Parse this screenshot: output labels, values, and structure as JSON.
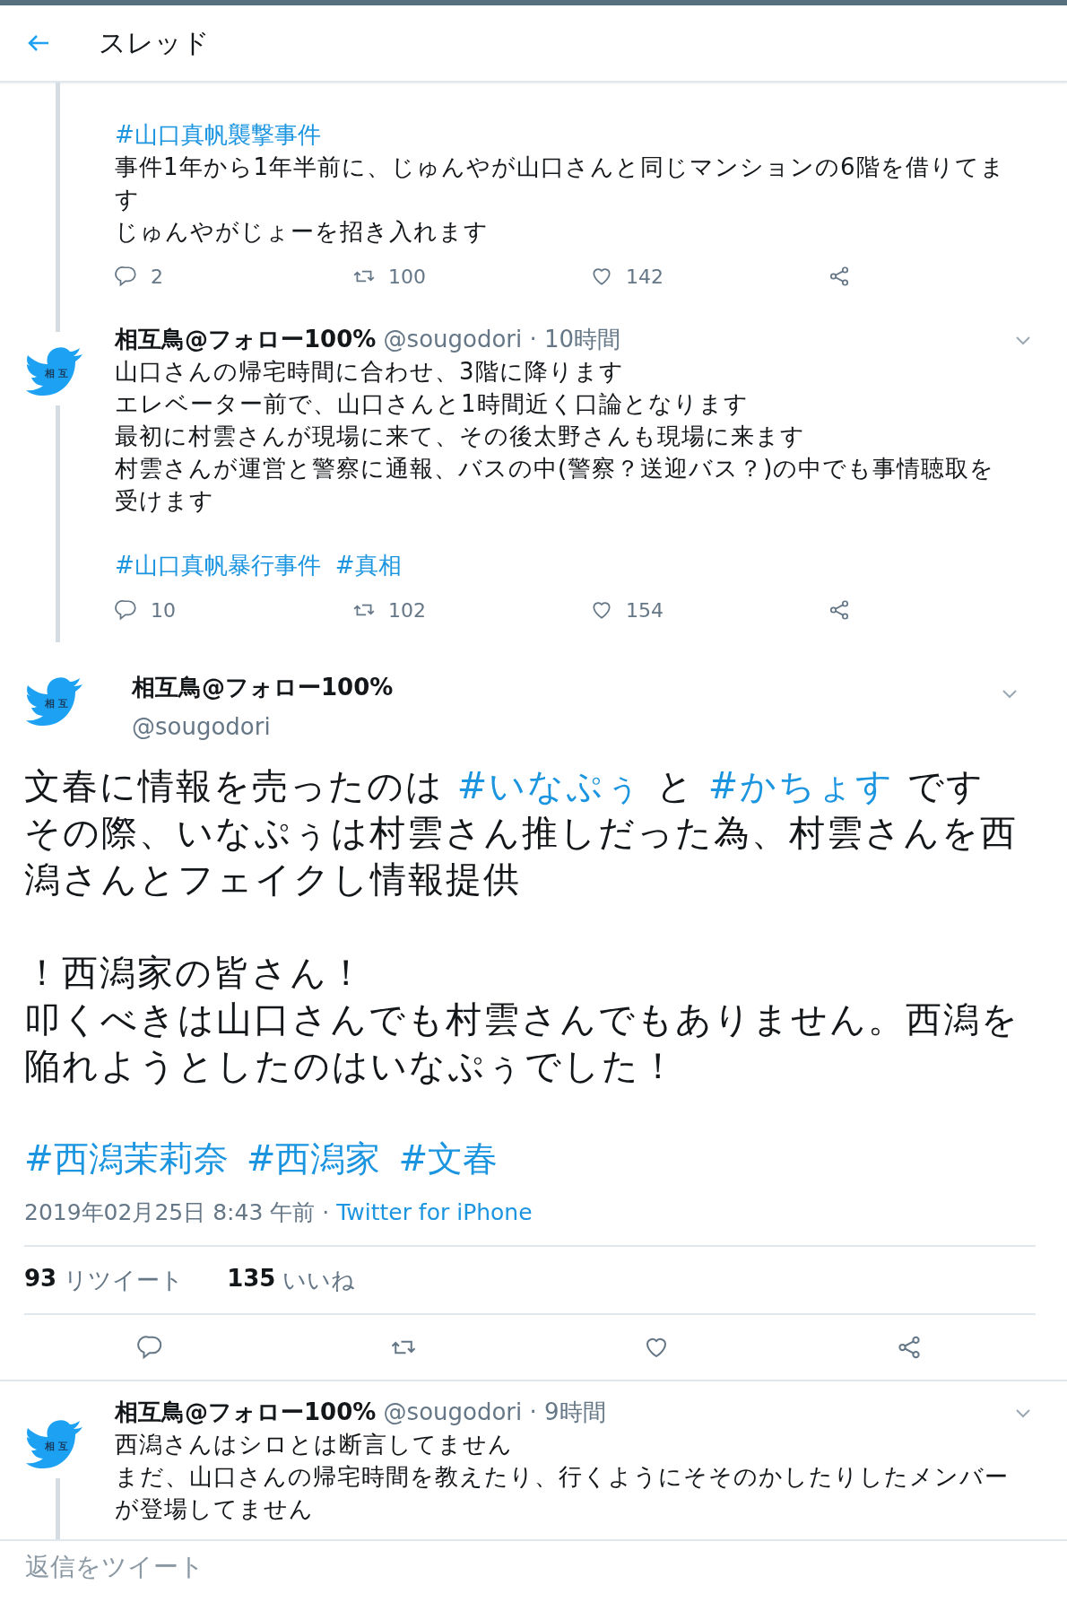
{
  "header": {
    "title": "スレッド"
  },
  "tweets": [
    {
      "kind": "cut",
      "line_above": true,
      "line_below": true,
      "blocks": [
        {
          "kind": "hashtags",
          "tags": [
            "#山口真帆襲撃事件"
          ]
        },
        {
          "kind": "text",
          "lines": [
            "事件1年から1年半前に、じゅんやが山口さんと同じマンションの6階を借りてます",
            "じゅんやがじょーを招き入れます"
          ]
        }
      ],
      "stats": [
        "2",
        "100",
        "142"
      ]
    },
    {
      "kind": "reply",
      "line_above": true,
      "line_below": true,
      "avatar_text": "相 互",
      "name": "相互鳥@フォロー100%",
      "handle": "@sougodori",
      "time": "· 10時間",
      "blocks": [
        {
          "kind": "text",
          "lines": [
            "山口さんの帰宅時間に合わせ、3階に降ります",
            "エレベーター前で、山口さんと1時間近く口論となります",
            "最初に村雲さんが現場に来て、その後太野さんも現場に来ます",
            "村雲さんが運営と警察に通報、バスの中(警察？送迎バス？)の中でも事情聴取を受けます"
          ]
        },
        {
          "kind": "hashtags",
          "tags": [
            "#山口真帆暴行事件",
            "#真相"
          ]
        }
      ],
      "stats": [
        "10",
        "102",
        "154"
      ]
    },
    {
      "kind": "focus",
      "avatar_text": "相 互",
      "name": "相互鳥@フォロー100%",
      "handle": "@sougodori",
      "paragraphs": [
        [
          [
            {
              "kind": "text",
              "text": "文春に情報を売ったのは "
            },
            {
              "kind": "hashtag",
              "text": "#いなぷぅ"
            },
            {
              "kind": "text",
              "text": " と "
            },
            {
              "kind": "hashtag",
              "text": "#かちょす"
            },
            {
              "kind": "text",
              "text": " です"
            }
          ],
          [
            {
              "kind": "text",
              "text": "その際、いなぷぅは村雲さん推しだった為、村雲さんを西潟さんとフェイクし情報提供"
            }
          ]
        ],
        [
          [
            {
              "kind": "text",
              "text": "！西潟家の皆さん！"
            }
          ],
          [
            {
              "kind": "text",
              "text": "叩くべきは山口さんでも村雲さんでもありません。西潟を陥れようとしたのはいなぷぅでした！"
            }
          ]
        ]
      ],
      "hashtags": [
        "#西潟茉莉奈",
        "#西潟家",
        "#文春"
      ],
      "date": "2019年02月25日 8:43 午前 · ",
      "source": "Twitter for iPhone",
      "counts": [
        {
          "value": "93",
          "label": "リツイート"
        },
        {
          "value": "135",
          "label": "いいね"
        }
      ]
    },
    {
      "kind": "reply",
      "line_above": false,
      "line_below": true,
      "avatar_text": "相 互",
      "name": "相互鳥@フォロー100%",
      "handle": "@sougodori",
      "time": "· 9時間",
      "blocks": [
        {
          "kind": "text",
          "lines": [
            "西潟さんはシロとは断言してません",
            "まだ、山口さんの帰宅時間を教えたり、行くようにそそのかしたりしたメンバーが登場してません"
          ]
        }
      ]
    }
  ],
  "reply_bar": {
    "placeholder": "返信をツイート"
  }
}
